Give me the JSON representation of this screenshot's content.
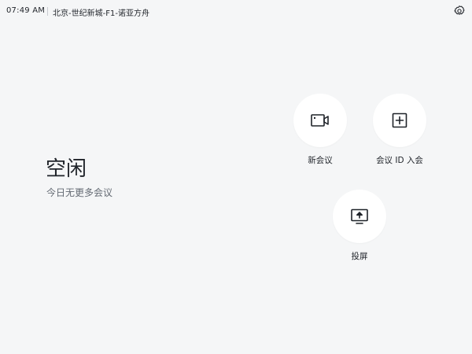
{
  "status_bar": {
    "time": "07:49 AM",
    "room_name": "北京-世纪新城-F1-诺亚方舟",
    "settings_icon": "gear-icon"
  },
  "status": {
    "title": "空闲",
    "subtitle": "今日无更多会议"
  },
  "actions": {
    "new_meeting": {
      "label": "新会议",
      "icon": "video-camera-icon"
    },
    "join_meeting": {
      "label": "会议 ID 入会",
      "icon": "plus-square-icon"
    },
    "screen_share": {
      "label": "投屏",
      "icon": "screen-share-icon"
    }
  },
  "colors": {
    "background": "#f5f6f7",
    "tile": "#ffffff",
    "text_primary": "#1f2329",
    "text_secondary": "#646a73"
  }
}
